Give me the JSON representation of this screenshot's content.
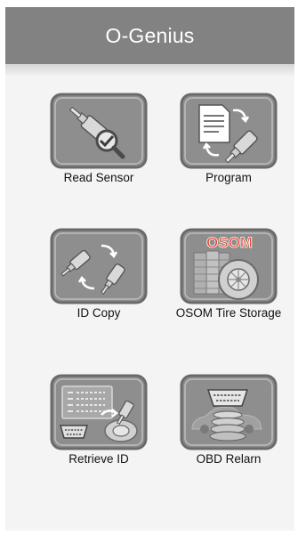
{
  "app": {
    "title": "O-Genius"
  },
  "menu": {
    "items": [
      {
        "label": "Read Sensor",
        "icon": "read-sensor-icon"
      },
      {
        "label": "Program",
        "icon": "program-icon"
      },
      {
        "label": "ID Copy",
        "icon": "id-copy-icon"
      },
      {
        "label": "OSOM Tire Storage",
        "icon": "osom-tire-storage-icon",
        "badge": "OSOM"
      },
      {
        "label": "Retrieve ID",
        "icon": "retrieve-id-icon"
      },
      {
        "label": "OBD Relarn",
        "icon": "obd-relearn-icon"
      }
    ]
  },
  "colors": {
    "header": "#828282",
    "tile": "#8e8e8e",
    "tile_border": "#6c6c6c",
    "badge": "#e0422c"
  }
}
